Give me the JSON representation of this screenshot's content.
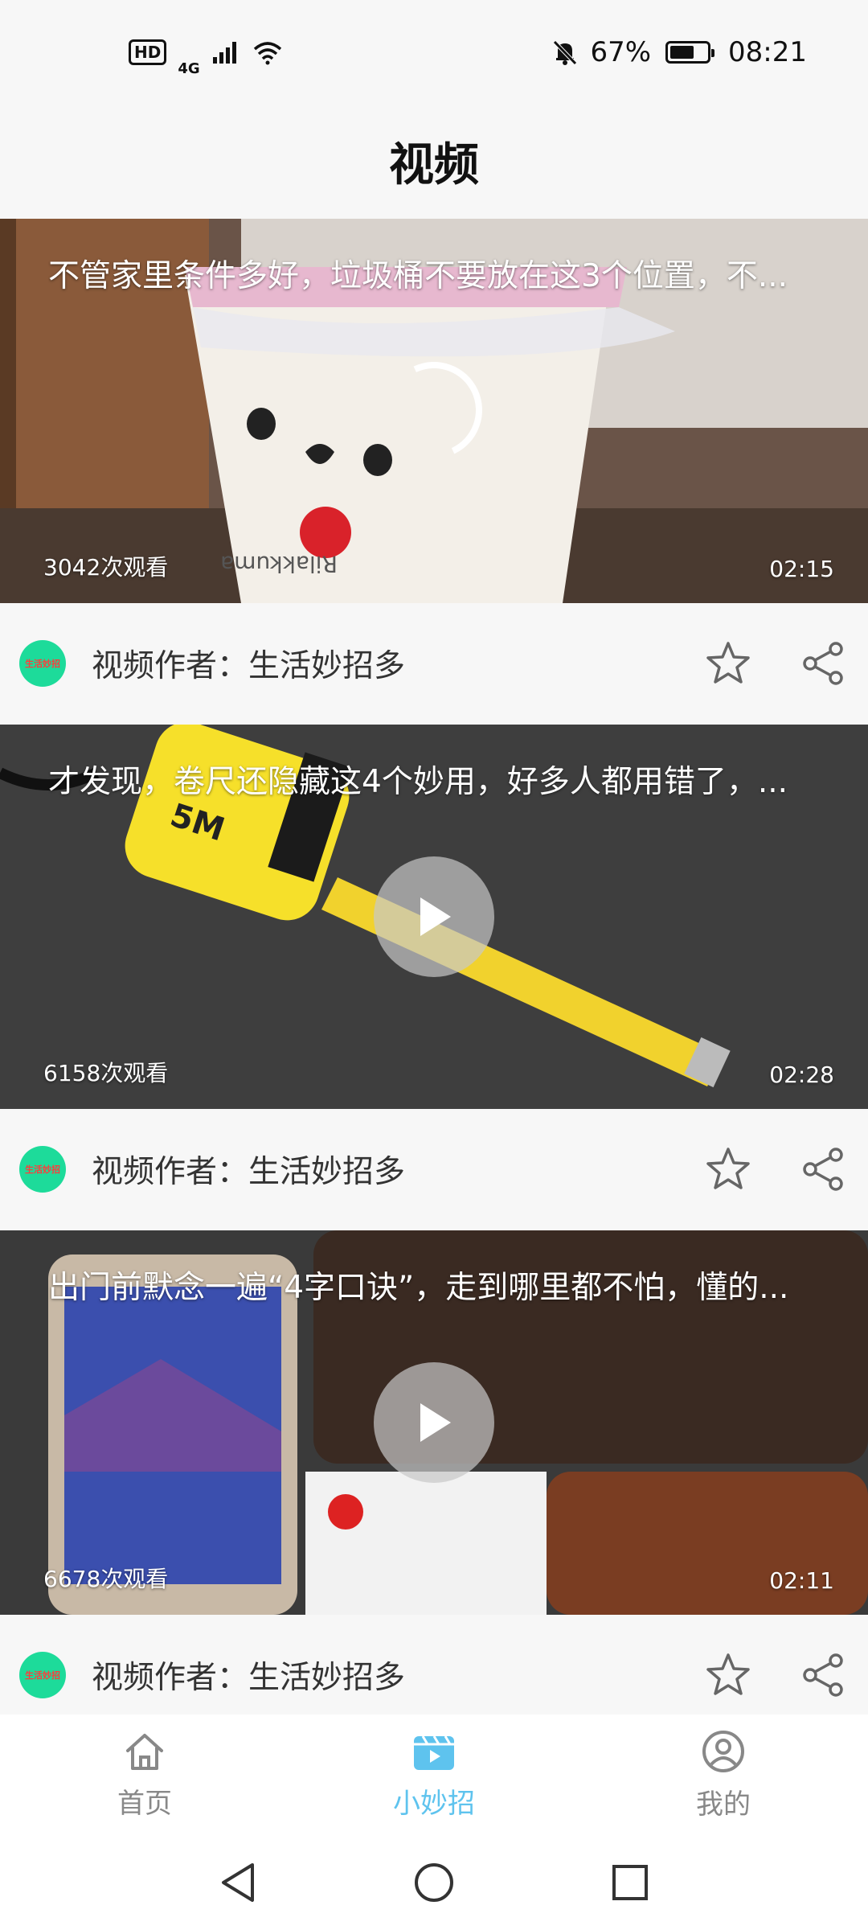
{
  "status_bar": {
    "hd": "HD",
    "network": "4G",
    "battery_percent": "67%",
    "battery_level": 0.67,
    "time": "08:21"
  },
  "header": {
    "title": "视频"
  },
  "videos": [
    {
      "title": "不管家里条件多好，垃圾桶不要放在这3个位置，不...",
      "views": "3042次观看",
      "duration": "02:15",
      "state": "loading",
      "author": "视频作者：生活妙招多",
      "avatar_text": "生活妙招"
    },
    {
      "title": "才发现，卷尺还隐藏这4个妙用，好多人都用错了，...",
      "views": "6158次观看",
      "duration": "02:28",
      "state": "paused",
      "author": "视频作者：生活妙招多",
      "avatar_text": "生活妙招"
    },
    {
      "title": "出门前默念一遍“4字口诀”，走到哪里都不怕，懂的...",
      "views": "6678次观看",
      "duration": "02:11",
      "state": "paused",
      "author": "视频作者：生活妙招多",
      "avatar_text": "生活妙招"
    }
  ],
  "tabs": [
    {
      "label": "首页",
      "icon": "home-icon",
      "active": false
    },
    {
      "label": "小妙招",
      "icon": "video-icon",
      "active": true
    },
    {
      "label": "我的",
      "icon": "profile-icon",
      "active": false
    }
  ],
  "colors": {
    "accent": "#5ec3ee",
    "avatar_bg": "#1ddb9a"
  }
}
